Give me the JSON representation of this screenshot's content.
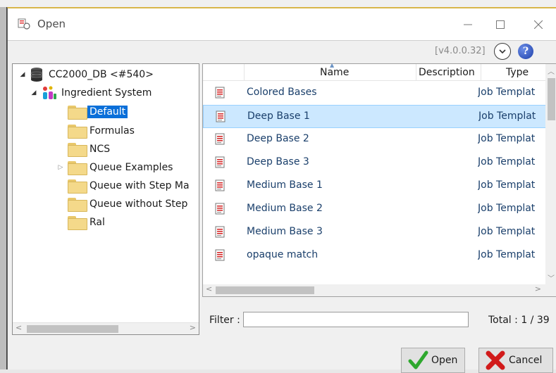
{
  "window": {
    "title": "Open",
    "version": "[v4.0.0.32]",
    "help_glyph": "?",
    "controls": {
      "minimize": "minimize-icon",
      "maximize": "maximize-icon",
      "close": "close-icon"
    }
  },
  "tree": {
    "items": [
      {
        "label": "CC2000_DB <#540>",
        "icon": "database-icon",
        "expander": "▲"
      },
      {
        "label": "Ingredient System",
        "icon": "ingredient-system-icon",
        "expander": "▲"
      },
      {
        "label": "Default",
        "icon": "folder-icon",
        "selected": true
      },
      {
        "label": "Formulas",
        "icon": "folder-icon"
      },
      {
        "label": "NCS",
        "icon": "folder-icon"
      },
      {
        "label": "Queue Examples",
        "icon": "folder-icon",
        "expander": "▷"
      },
      {
        "label": "Queue with Step Ma",
        "icon": "folder-icon"
      },
      {
        "label": "Queue without Step",
        "icon": "folder-icon"
      },
      {
        "label": "Ral",
        "icon": "folder-icon"
      }
    ]
  },
  "list": {
    "columns": {
      "name": "Name",
      "description": "Description",
      "type": "Type"
    },
    "rows": [
      {
        "name": "Colored Bases",
        "type": "Job Templat"
      },
      {
        "name": "Deep Base 1",
        "type": "Job Templat",
        "selected": true
      },
      {
        "name": "Deep Base 2",
        "type": "Job Templat"
      },
      {
        "name": "Deep Base 3",
        "type": "Job Templat"
      },
      {
        "name": "Medium Base 1",
        "type": "Job Templat"
      },
      {
        "name": "Medium Base 2",
        "type": "Job Templat"
      },
      {
        "name": "Medium Base 3",
        "type": "Job Templat"
      },
      {
        "name": "opaque match",
        "type": "Job Templat"
      }
    ]
  },
  "filter": {
    "label": "Filter :",
    "value": ""
  },
  "total": "Total :  1 / 39",
  "buttons": {
    "open": "Open",
    "cancel": "Cancel"
  },
  "colors": {
    "selection": "#0a6fd9",
    "row_selected": "#cce8ff",
    "open_check": "#2ea82e",
    "cancel_x": "#d11a1a"
  }
}
